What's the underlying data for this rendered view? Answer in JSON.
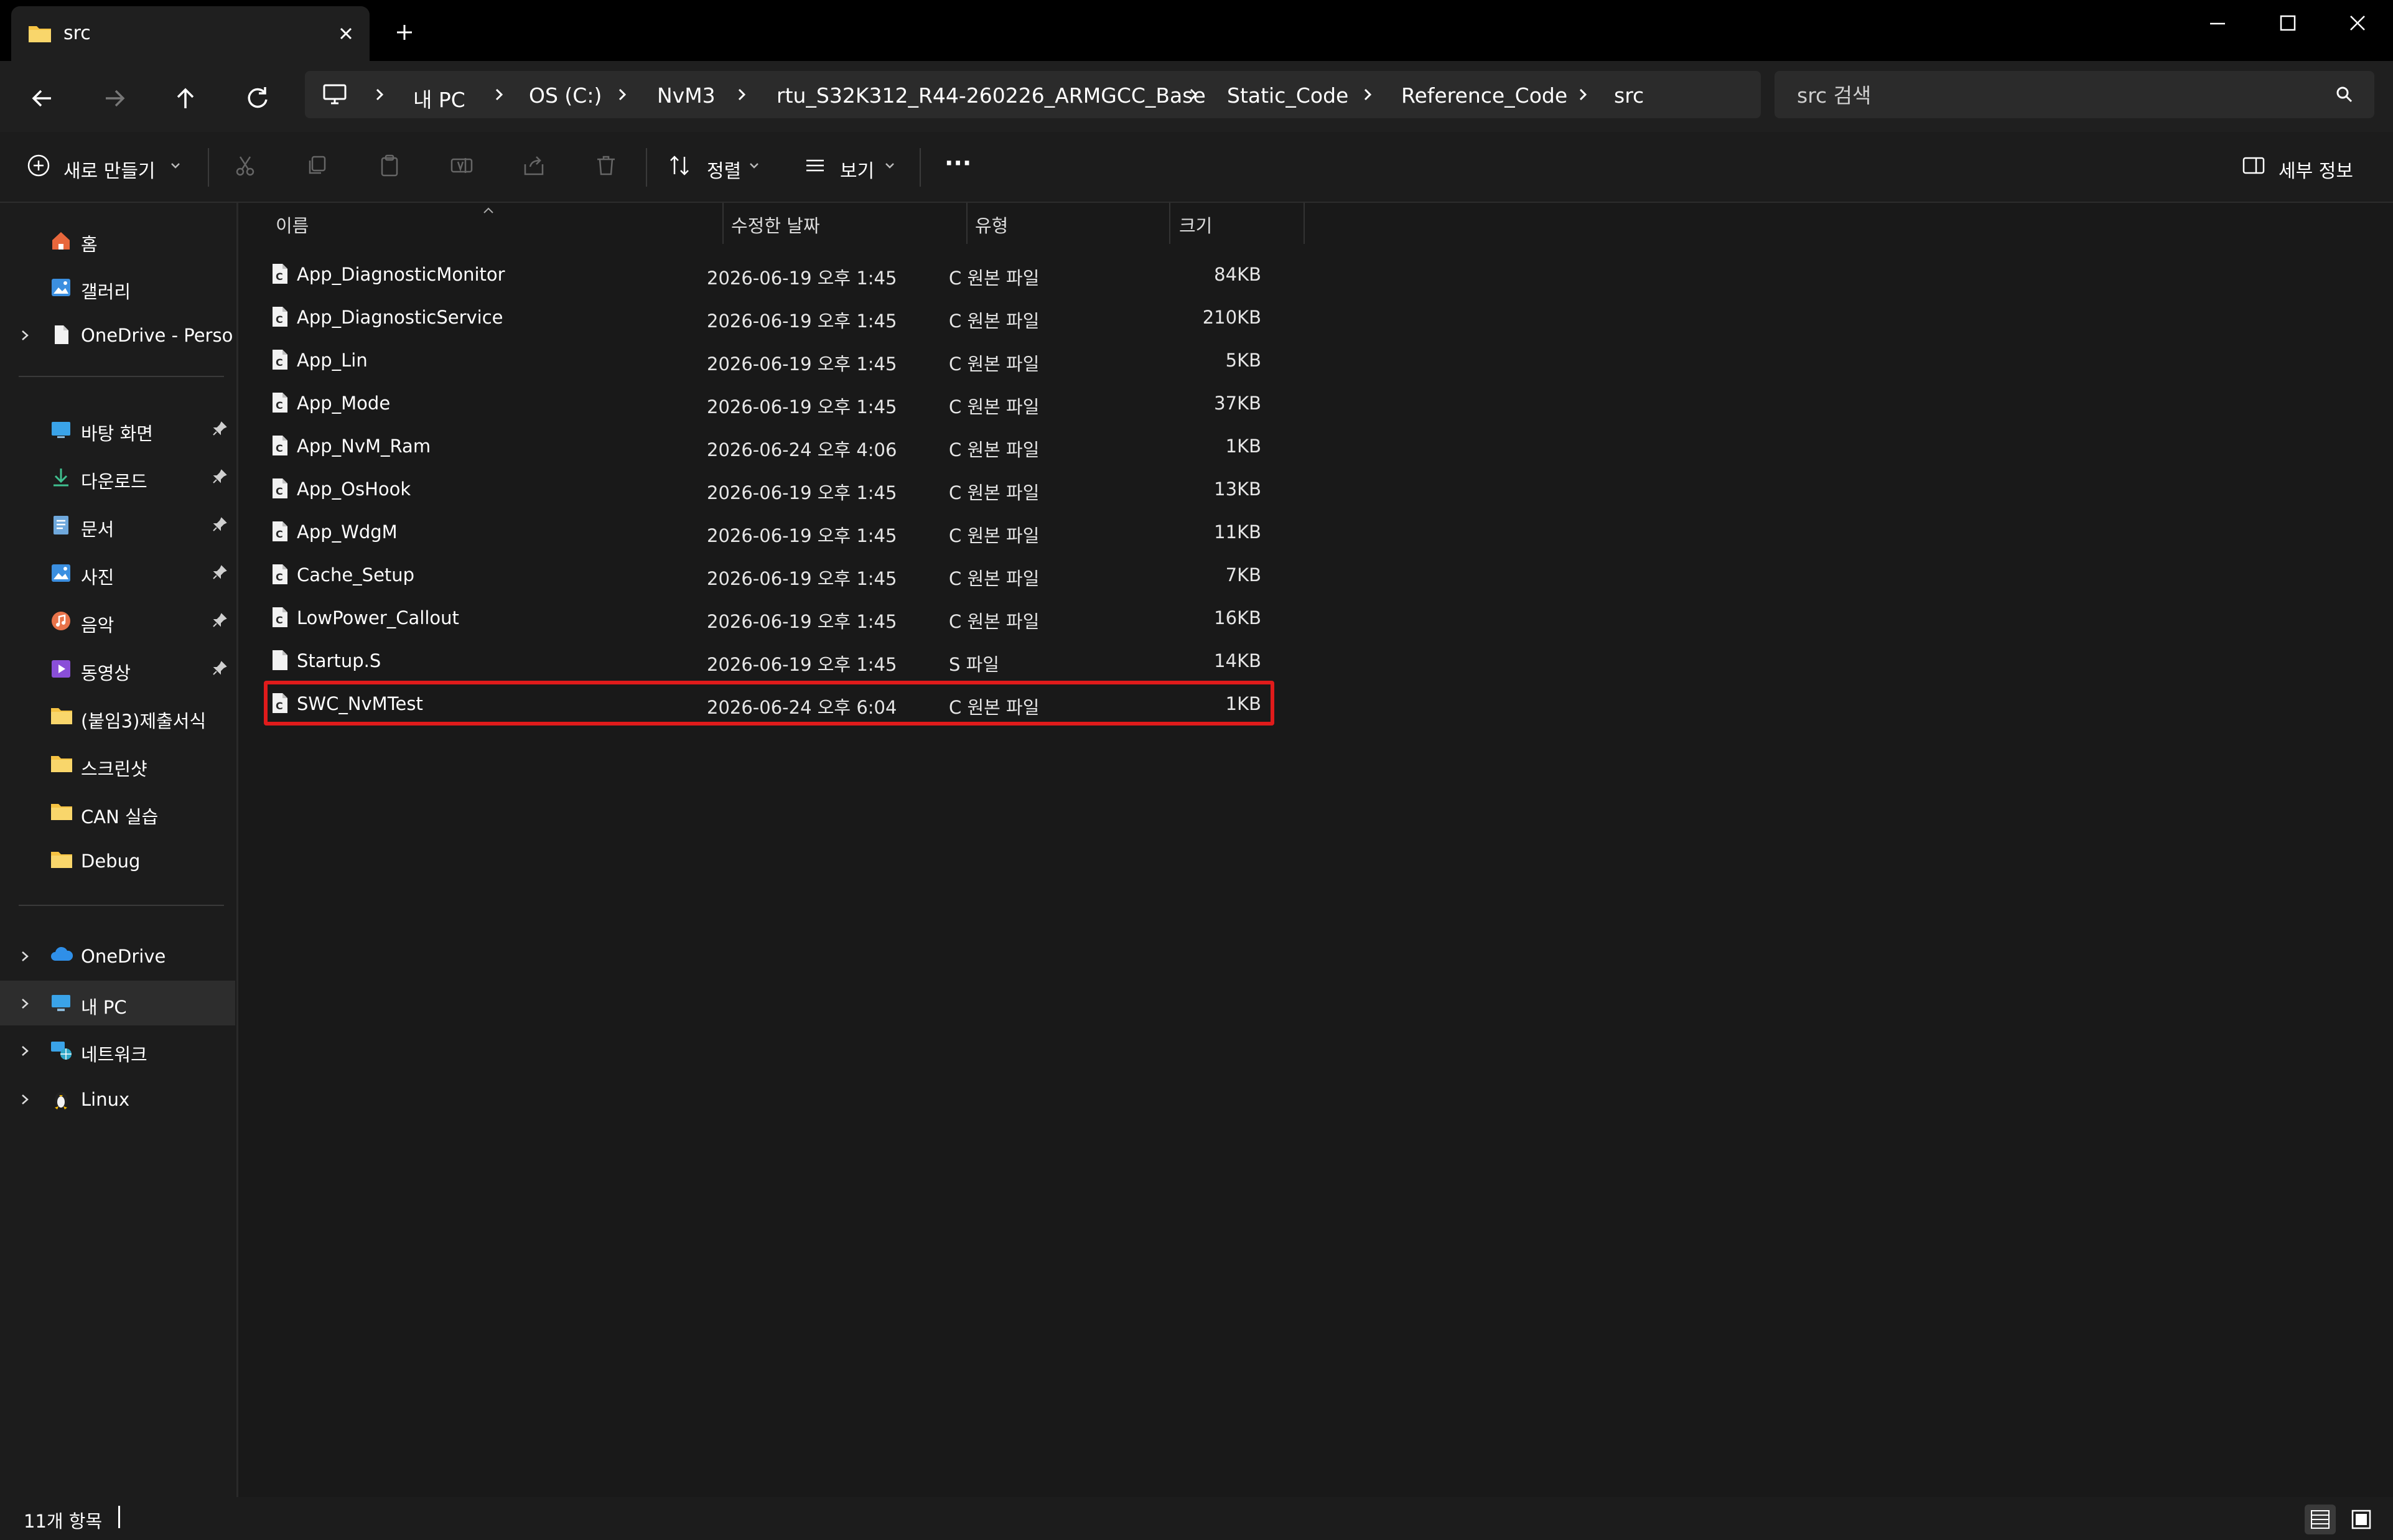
{
  "window": {
    "tab_title": "src",
    "colors": {
      "titlebar": "#000000",
      "surface": "#1f1f1f",
      "background": "#191919",
      "highlight": "#e01b1b",
      "folder": "#f6c343"
    }
  },
  "navigation": {
    "icons": [
      "back-arrow-icon",
      "forward-arrow-icon",
      "up-arrow-icon",
      "refresh-icon",
      "monitor-icon"
    ],
    "breadcrumbs": [
      "내 PC",
      "OS (C:)",
      "NvM3",
      "rtu_S32K312_R44-260226_ARMGCC_Base",
      "Static_Code",
      "Reference_Code",
      "src"
    ],
    "search_placeholder": "src 검색"
  },
  "toolbar": {
    "new_label": "새로 만들기",
    "sort_label": "정렬",
    "view_label": "보기",
    "more_label": "···",
    "details_label": "세부 정보",
    "icons": [
      "cut-icon",
      "copy-icon",
      "paste-icon",
      "rename-icon",
      "share-icon",
      "delete-icon"
    ]
  },
  "sidebar": {
    "top": [
      {
        "label": "홈",
        "icon": "home-icon"
      },
      {
        "label": "갤러리",
        "icon": "gallery-icon"
      },
      {
        "label": "OneDrive - Personal",
        "icon": "document-icon"
      }
    ],
    "pinned": [
      {
        "label": "바탕 화면",
        "icon": "desktop-icon"
      },
      {
        "label": "다운로드",
        "icon": "download-icon"
      },
      {
        "label": "문서",
        "icon": "documents-icon"
      },
      {
        "label": "사진",
        "icon": "pictures-icon"
      },
      {
        "label": "음악",
        "icon": "music-icon"
      },
      {
        "label": "동영상",
        "icon": "video-icon"
      },
      {
        "label": "(붙임3)제출서식",
        "icon": "folder-icon"
      },
      {
        "label": "스크린샷",
        "icon": "folder-icon"
      },
      {
        "label": "CAN 실습",
        "icon": "folder-icon"
      },
      {
        "label": "Debug",
        "icon": "folder-icon"
      }
    ],
    "bottom": [
      {
        "label": "OneDrive",
        "icon": "cloud-icon"
      },
      {
        "label": "내 PC",
        "icon": "pc-icon",
        "selected": true
      },
      {
        "label": "네트워크",
        "icon": "network-icon"
      },
      {
        "label": "Linux",
        "icon": "linux-icon"
      }
    ]
  },
  "columns": {
    "name": "이름",
    "date": "수정한 날짜",
    "type": "유형",
    "size": "크기"
  },
  "files": [
    {
      "name": "App_DiagnosticMonitor",
      "date": "2026-06-19 오후 1:45",
      "type": "C 원본 파일",
      "size": "84KB",
      "icon": "c-file-icon"
    },
    {
      "name": "App_DiagnosticService",
      "date": "2026-06-19 오후 1:45",
      "type": "C 원본 파일",
      "size": "210KB",
      "icon": "c-file-icon"
    },
    {
      "name": "App_Lin",
      "date": "2026-06-19 오후 1:45",
      "type": "C 원본 파일",
      "size": "5KB",
      "icon": "c-file-icon"
    },
    {
      "name": "App_Mode",
      "date": "2026-06-19 오후 1:45",
      "type": "C 원본 파일",
      "size": "37KB",
      "icon": "c-file-icon"
    },
    {
      "name": "App_NvM_Ram",
      "date": "2026-06-24 오후 4:06",
      "type": "C 원본 파일",
      "size": "1KB",
      "icon": "c-file-icon"
    },
    {
      "name": "App_OsHook",
      "date": "2026-06-19 오후 1:45",
      "type": "C 원본 파일",
      "size": "13KB",
      "icon": "c-file-icon"
    },
    {
      "name": "App_WdgM",
      "date": "2026-06-19 오후 1:45",
      "type": "C 원본 파일",
      "size": "11KB",
      "icon": "c-file-icon"
    },
    {
      "name": "Cache_Setup",
      "date": "2026-06-19 오후 1:45",
      "type": "C 원본 파일",
      "size": "7KB",
      "icon": "c-file-icon"
    },
    {
      "name": "LowPower_Callout",
      "date": "2026-06-19 오후 1:45",
      "type": "C 원본 파일",
      "size": "16KB",
      "icon": "c-file-icon"
    },
    {
      "name": "Startup.S",
      "date": "2026-06-19 오후 1:45",
      "type": "S 파일",
      "size": "14KB",
      "icon": "generic-file-icon"
    },
    {
      "name": "SWC_NvMTest",
      "date": "2026-06-24 오후 6:04",
      "type": "C 원본 파일",
      "size": "1KB",
      "icon": "c-file-icon",
      "highlighted": true
    }
  ],
  "status": {
    "item_count": "11개 항목"
  }
}
